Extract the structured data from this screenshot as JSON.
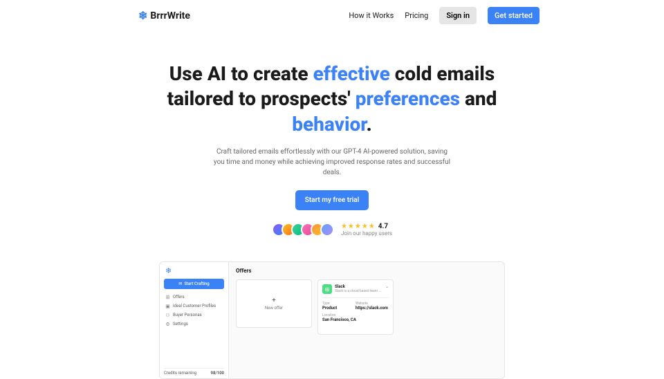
{
  "nav": {
    "brand": "BrrrWrite",
    "how": "How it Works",
    "pricing": "Pricing",
    "signin": "Sign in",
    "getstarted": "Get started"
  },
  "hero": {
    "t1": "Use AI to create ",
    "h1": "effective",
    "t2": " cold emails tailored to prospects' ",
    "h2": "preferences",
    "t3": " and ",
    "h3": "behavior",
    "t4": ".",
    "sub": "Craft tailored emails effortlessly with our GPT-4 AI-powered solution, saving you time and money while achieving improved response rates and successful deals.",
    "cta": "Start my free trial",
    "stars": "★★★★★",
    "rating": "4.7",
    "join": "Join our happy users"
  },
  "app": {
    "craft": "Start Crafting",
    "side": [
      "Offers",
      "Ideal Customer Profiles",
      "Buyer Personas",
      "Settings"
    ],
    "credits_lbl": "Credits remaining",
    "credits_val": "98/100",
    "title": "Offers",
    "newoffer": "New offer",
    "offer": {
      "name": "Slack",
      "desc": "Slack is a cloud-based team c...",
      "type_lbl": "Type",
      "type": "Product",
      "web_lbl": "Website",
      "web": "https://slack.com",
      "loc_lbl": "Location",
      "loc": "San Francisco, CA"
    }
  }
}
